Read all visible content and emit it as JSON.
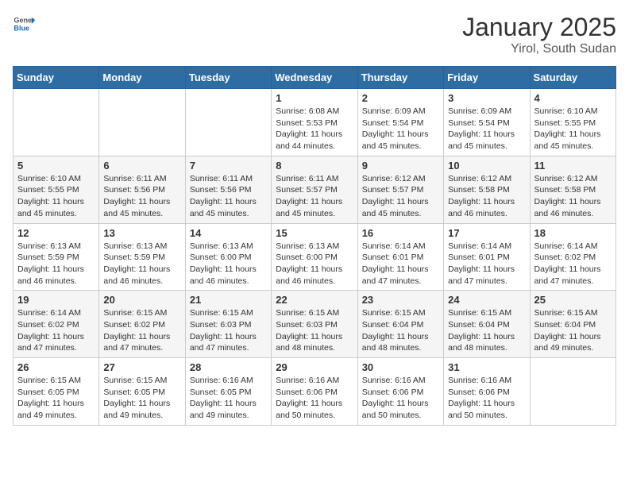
{
  "header": {
    "logo_general": "General",
    "logo_blue": "Blue",
    "title": "January 2025",
    "subtitle": "Yirol, South Sudan"
  },
  "weekdays": [
    "Sunday",
    "Monday",
    "Tuesday",
    "Wednesday",
    "Thursday",
    "Friday",
    "Saturday"
  ],
  "weeks": [
    [
      {
        "day": "",
        "info": ""
      },
      {
        "day": "",
        "info": ""
      },
      {
        "day": "",
        "info": ""
      },
      {
        "day": "1",
        "info": "Sunrise: 6:08 AM\nSunset: 5:53 PM\nDaylight: 11 hours and 44 minutes."
      },
      {
        "day": "2",
        "info": "Sunrise: 6:09 AM\nSunset: 5:54 PM\nDaylight: 11 hours and 45 minutes."
      },
      {
        "day": "3",
        "info": "Sunrise: 6:09 AM\nSunset: 5:54 PM\nDaylight: 11 hours and 45 minutes."
      },
      {
        "day": "4",
        "info": "Sunrise: 6:10 AM\nSunset: 5:55 PM\nDaylight: 11 hours and 45 minutes."
      }
    ],
    [
      {
        "day": "5",
        "info": "Sunrise: 6:10 AM\nSunset: 5:55 PM\nDaylight: 11 hours and 45 minutes."
      },
      {
        "day": "6",
        "info": "Sunrise: 6:11 AM\nSunset: 5:56 PM\nDaylight: 11 hours and 45 minutes."
      },
      {
        "day": "7",
        "info": "Sunrise: 6:11 AM\nSunset: 5:56 PM\nDaylight: 11 hours and 45 minutes."
      },
      {
        "day": "8",
        "info": "Sunrise: 6:11 AM\nSunset: 5:57 PM\nDaylight: 11 hours and 45 minutes."
      },
      {
        "day": "9",
        "info": "Sunrise: 6:12 AM\nSunset: 5:57 PM\nDaylight: 11 hours and 45 minutes."
      },
      {
        "day": "10",
        "info": "Sunrise: 6:12 AM\nSunset: 5:58 PM\nDaylight: 11 hours and 46 minutes."
      },
      {
        "day": "11",
        "info": "Sunrise: 6:12 AM\nSunset: 5:58 PM\nDaylight: 11 hours and 46 minutes."
      }
    ],
    [
      {
        "day": "12",
        "info": "Sunrise: 6:13 AM\nSunset: 5:59 PM\nDaylight: 11 hours and 46 minutes."
      },
      {
        "day": "13",
        "info": "Sunrise: 6:13 AM\nSunset: 5:59 PM\nDaylight: 11 hours and 46 minutes."
      },
      {
        "day": "14",
        "info": "Sunrise: 6:13 AM\nSunset: 6:00 PM\nDaylight: 11 hours and 46 minutes."
      },
      {
        "day": "15",
        "info": "Sunrise: 6:13 AM\nSunset: 6:00 PM\nDaylight: 11 hours and 46 minutes."
      },
      {
        "day": "16",
        "info": "Sunrise: 6:14 AM\nSunset: 6:01 PM\nDaylight: 11 hours and 47 minutes."
      },
      {
        "day": "17",
        "info": "Sunrise: 6:14 AM\nSunset: 6:01 PM\nDaylight: 11 hours and 47 minutes."
      },
      {
        "day": "18",
        "info": "Sunrise: 6:14 AM\nSunset: 6:02 PM\nDaylight: 11 hours and 47 minutes."
      }
    ],
    [
      {
        "day": "19",
        "info": "Sunrise: 6:14 AM\nSunset: 6:02 PM\nDaylight: 11 hours and 47 minutes."
      },
      {
        "day": "20",
        "info": "Sunrise: 6:15 AM\nSunset: 6:02 PM\nDaylight: 11 hours and 47 minutes."
      },
      {
        "day": "21",
        "info": "Sunrise: 6:15 AM\nSunset: 6:03 PM\nDaylight: 11 hours and 47 minutes."
      },
      {
        "day": "22",
        "info": "Sunrise: 6:15 AM\nSunset: 6:03 PM\nDaylight: 11 hours and 48 minutes."
      },
      {
        "day": "23",
        "info": "Sunrise: 6:15 AM\nSunset: 6:04 PM\nDaylight: 11 hours and 48 minutes."
      },
      {
        "day": "24",
        "info": "Sunrise: 6:15 AM\nSunset: 6:04 PM\nDaylight: 11 hours and 48 minutes."
      },
      {
        "day": "25",
        "info": "Sunrise: 6:15 AM\nSunset: 6:04 PM\nDaylight: 11 hours and 49 minutes."
      }
    ],
    [
      {
        "day": "26",
        "info": "Sunrise: 6:15 AM\nSunset: 6:05 PM\nDaylight: 11 hours and 49 minutes."
      },
      {
        "day": "27",
        "info": "Sunrise: 6:15 AM\nSunset: 6:05 PM\nDaylight: 11 hours and 49 minutes."
      },
      {
        "day": "28",
        "info": "Sunrise: 6:16 AM\nSunset: 6:05 PM\nDaylight: 11 hours and 49 minutes."
      },
      {
        "day": "29",
        "info": "Sunrise: 6:16 AM\nSunset: 6:06 PM\nDaylight: 11 hours and 50 minutes."
      },
      {
        "day": "30",
        "info": "Sunrise: 6:16 AM\nSunset: 6:06 PM\nDaylight: 11 hours and 50 minutes."
      },
      {
        "day": "31",
        "info": "Sunrise: 6:16 AM\nSunset: 6:06 PM\nDaylight: 11 hours and 50 minutes."
      },
      {
        "day": "",
        "info": ""
      }
    ]
  ]
}
